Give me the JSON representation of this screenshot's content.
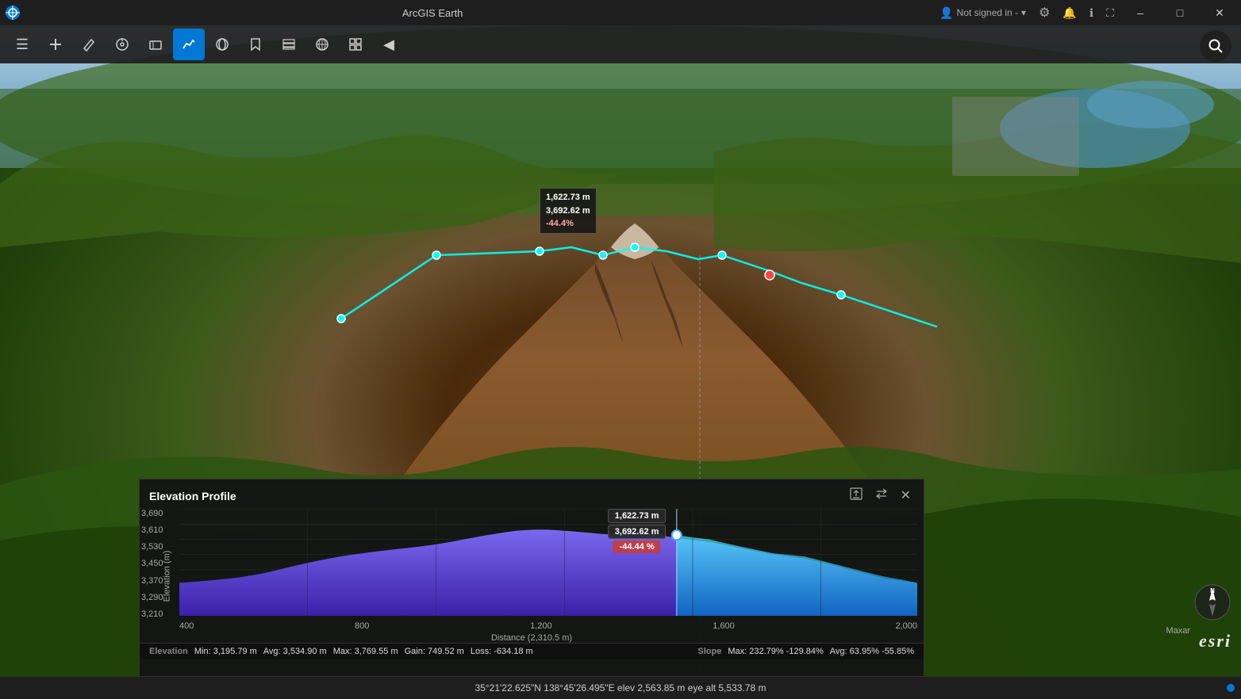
{
  "app": {
    "title": "ArcGIS Earth",
    "icon": "🌍"
  },
  "titlebar": {
    "not_signed_in": "Not signed in -",
    "settings_icon": "⚙",
    "bell_icon": "🔔",
    "info_icon": "ℹ",
    "fullscreen_icon": "⛶",
    "minimize": "–",
    "maximize": "□",
    "close": "✕"
  },
  "toolbar": {
    "items": [
      {
        "id": "menu",
        "icon": "☰",
        "label": "Menu"
      },
      {
        "id": "add",
        "icon": "+",
        "label": "Add"
      },
      {
        "id": "sketch",
        "icon": "✏",
        "label": "Sketch"
      },
      {
        "id": "measure-loop",
        "icon": "⊕",
        "label": "Measure Loop"
      },
      {
        "id": "erase",
        "icon": "⌫",
        "label": "Erase"
      },
      {
        "id": "elevation-profile",
        "icon": "📈",
        "label": "Elevation Profile",
        "active": true
      },
      {
        "id": "overlay",
        "icon": "◎",
        "label": "Overlay"
      },
      {
        "id": "bookmark",
        "icon": "🔖",
        "label": "Bookmark"
      },
      {
        "id": "layers",
        "icon": "▦",
        "label": "Layers"
      },
      {
        "id": "globe",
        "icon": "🌐",
        "label": "Globe"
      },
      {
        "id": "grid",
        "icon": "⊞",
        "label": "Grid"
      },
      {
        "id": "collapse",
        "icon": "◀",
        "label": "Collapse"
      }
    ]
  },
  "map": {
    "annotation": {
      "line1": "1,622.73 m",
      "line2": "3,692.62 m",
      "line3": "-44.4%"
    }
  },
  "elevation_profile": {
    "title": "Elevation Profile",
    "tooltip": {
      "distance": "1,622.73 m",
      "elevation": "3,692.62 m",
      "slope": "-44.44 %"
    },
    "y_axis": {
      "label": "Elevation (m)",
      "values": [
        "3,690",
        "3,610",
        "3,530",
        "3,450",
        "3,370",
        "3,290",
        "3,210"
      ]
    },
    "x_axis": {
      "label": "Distance (2,310.5  m)",
      "values": [
        "400",
        "800",
        "1,200",
        "1,600",
        "2,000"
      ]
    },
    "stats": {
      "elevation_label": "Elevation",
      "min": "Min: 3,195.79 m",
      "avg": "Avg: 3,534.90 m",
      "max": "Max: 3,769.55 m",
      "gain": "Gain: 749.52 m",
      "loss": "Loss: -634.18 m",
      "slope_label": "Slope",
      "slope_max": "Max: 232.79% -129.84%",
      "slope_avg": "Avg: 63.95% -55.85%"
    }
  },
  "statusbar": {
    "coordinates": "35°21'22.625\"N 138°45'26.495\"E  elev 2,563.85 m  eye alt 5,533.78 m"
  },
  "branding": {
    "esri": "esri",
    "maxar": "Maxar"
  }
}
